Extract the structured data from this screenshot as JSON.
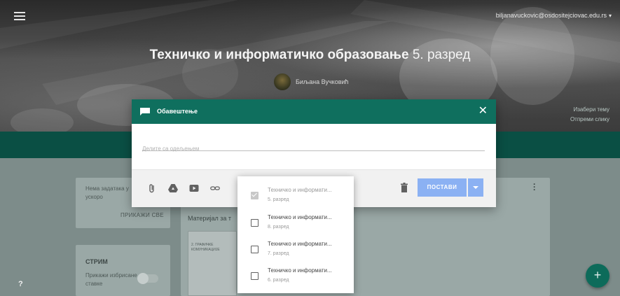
{
  "header": {
    "account": "biljanavuckovic@osdositejciovac.edu.rs",
    "class_title": "Техничко и информатичко образовање",
    "class_grade": "5. разред",
    "teacher_name": "Биљана Вучковић",
    "side_links": [
      "Изабери тему",
      "Отпреми слику"
    ]
  },
  "background": {
    "no_tasks": "Нема задатака у",
    "no_tasks_2": "ускоро",
    "show_all": "ПРИКАЖИ СВЕ",
    "material": "Материјал за т",
    "stream": "СТРИМ",
    "show_deleted": "Прикажи избрисане",
    "show_deleted_2": "ставке",
    "thumb_text": "2. ГРАФИЧКЕ КОМУНИКАЦИЈЕ",
    "help": "?",
    "fab": "+"
  },
  "dialog": {
    "title": "Обавештење",
    "close": "✕",
    "placeholder": "Делите са одељењем",
    "post_label": "ПОСТАВИ",
    "tools": [
      "paperclip-icon",
      "drive-icon",
      "youtube-icon",
      "link-icon"
    ]
  },
  "picker": {
    "options": [
      {
        "name": "Техничко и информати...",
        "grade": "5. разред",
        "checked": true
      },
      {
        "name": "Техничко и информати...",
        "grade": "8. разред",
        "checked": false
      },
      {
        "name": "Техничко и информати...",
        "grade": "7. разред",
        "checked": false
      },
      {
        "name": "Техничко и информати...",
        "grade": "6. разред",
        "checked": false
      }
    ]
  },
  "colors": {
    "header_green": "#0f6f5e",
    "dark_green": "#0a4f44",
    "post_button": "#8bb1f3",
    "fab": "#0d6b5a"
  }
}
